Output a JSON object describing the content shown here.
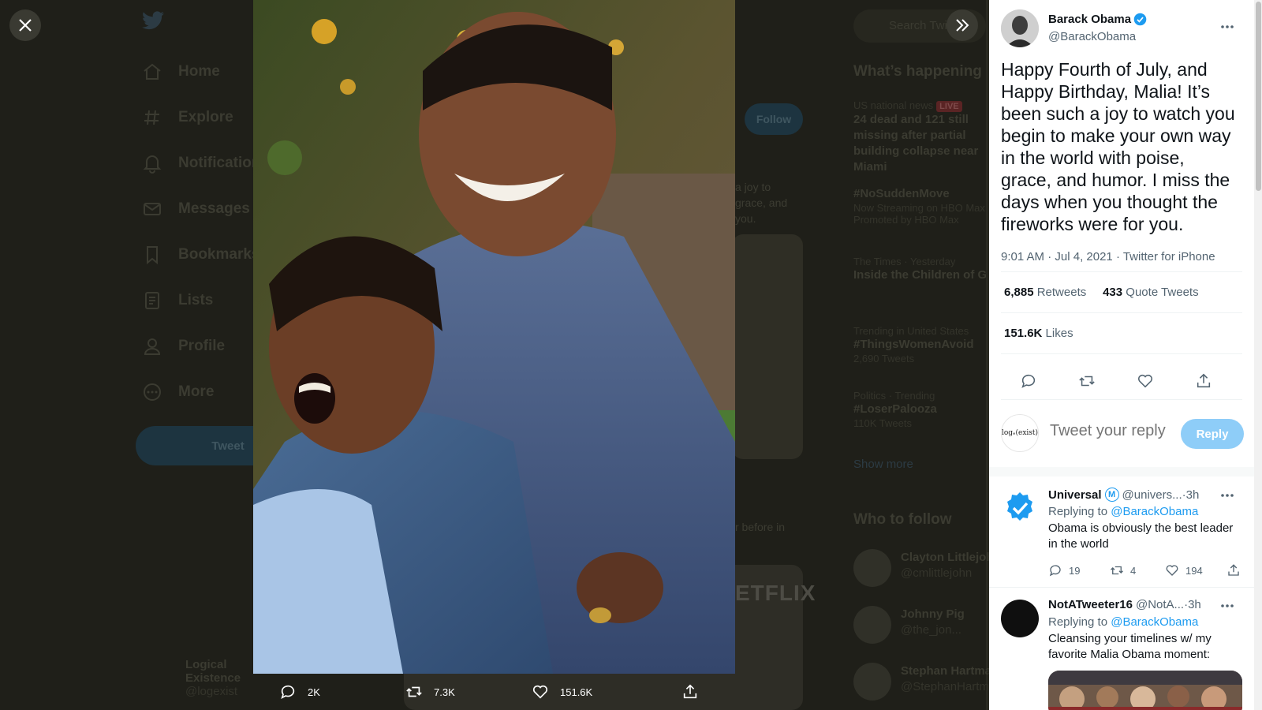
{
  "background": {
    "nav": [
      "Home",
      "Explore",
      "Notifications",
      "Messages",
      "Bookmarks",
      "Lists",
      "Profile",
      "More"
    ],
    "tweet_button": "Tweet",
    "follow_button": "Follow",
    "user": {
      "name": "Logical Existence",
      "handle": "@logexist"
    },
    "search_placeholder": "Search Twitter",
    "whats_happening": "What’s happening",
    "trends": [
      {
        "category": "US national news",
        "live": "LIVE",
        "title": "24 dead and 121 still missing after partial building collapse near Miami"
      },
      {
        "category": "",
        "title": "#NoSuddenMove",
        "sub": "Now Streaming on HBO Max",
        "promo": "Promoted by HBO Max"
      },
      {
        "category": "The Times · Yesterday",
        "title": "Inside the Children of God"
      },
      {
        "category": "Trending in United States",
        "title": "#ThingsWomenAvoid",
        "sub": "2,690 Tweets"
      },
      {
        "category": "Politics · Trending",
        "title": "#LoserPalooza",
        "sub": "110K Tweets"
      }
    ],
    "show_more": "Show more",
    "who_to_follow": "Who to follow",
    "follow_suggestions": [
      {
        "name": "Clayton Littlejohn",
        "handle": "@cmlittlejohn"
      },
      {
        "name": "Johnny Pig",
        "handle": "@the_jon..."
      },
      {
        "name": "Stephan Hartmann",
        "handle": "@StephanHartmann"
      }
    ],
    "snippets": [
      "a joy to",
      "grace, and",
      "you.",
      "r before in"
    ],
    "netflix": "ETFLIX"
  },
  "photo_actions": {
    "replies": "2K",
    "retweets": "7.3K",
    "likes": "151.6K"
  },
  "tweet": {
    "author_name": "Barack Obama",
    "author_handle": "@BarackObama",
    "text": "Happy Fourth of July, and Happy Birthday, Malia! It’s been such a joy to watch you begin to make your own way in the world with poise, grace, and humor. I miss the days when you thought the fireworks were for you.",
    "time": "9:01 AM",
    "date": "Jul 4, 2021",
    "source": "Twitter for iPhone",
    "sep": " · ",
    "retweets_count": "6,885",
    "retweets_label": "Retweets",
    "quotes_count": "433",
    "quotes_label": "Quote Tweets",
    "likes_count": "151.6K",
    "likes_label": "Likes"
  },
  "reply_box": {
    "avatar_text": "logₑ(exist)",
    "placeholder": "Tweet your reply",
    "button": "Reply"
  },
  "replies": [
    {
      "name": "Universal",
      "badge": "M",
      "handle": "@univers...",
      "time": "3h",
      "replying_prefix": "Replying to ",
      "replying_to": "@BarackObama",
      "text": "Obama is obviously the best leader in the world",
      "replies": "19",
      "retweets": "4",
      "likes": "194"
    },
    {
      "name": "NotATweeter16",
      "handle": "@NotA...",
      "time": "3h",
      "replying_prefix": "Replying to ",
      "replying_to": "@BarackObama",
      "text": "Cleansing your timelines w/ my favorite Malia Obama moment:"
    }
  ],
  "colors": {
    "accent": "#1d9bf0",
    "reply_button": "#8ecdf8",
    "overlay": "#1f1f19"
  }
}
